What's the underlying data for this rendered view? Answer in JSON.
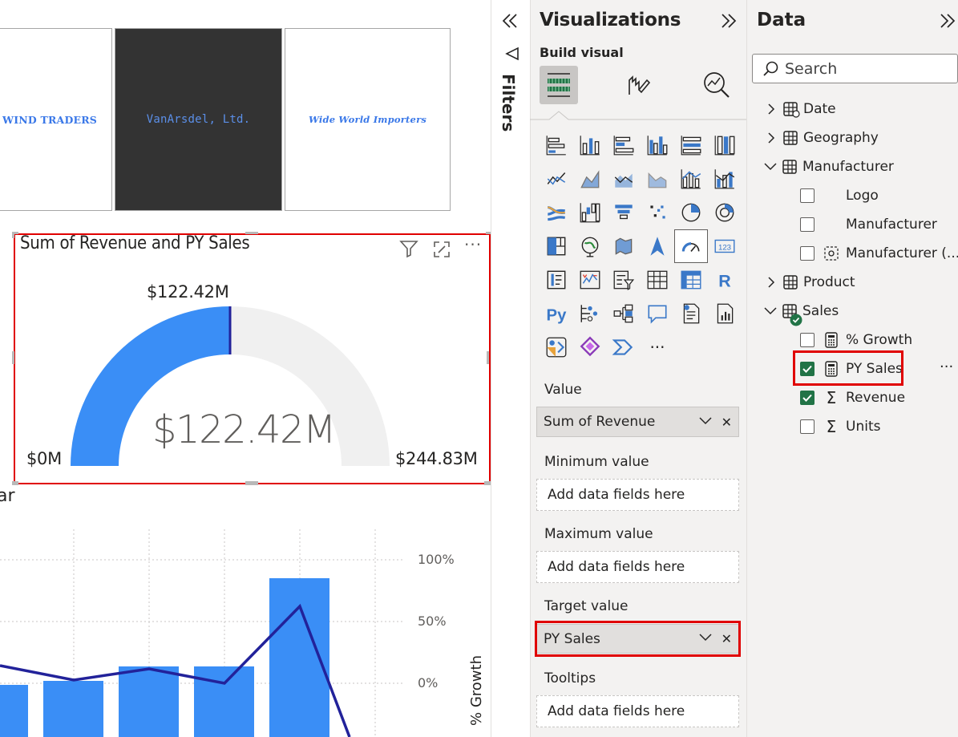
{
  "canvas": {
    "logos": [
      {
        "text": "WIND TRADERS",
        "color": "#3a78e8"
      },
      {
        "text": "VanArsdel, Ltd.",
        "color": "#5b8fe8"
      },
      {
        "text": "Wide World Importers",
        "color": "#3a78e8"
      }
    ],
    "gauge": {
      "title": "Sum of Revenue and PY Sales",
      "target_label": "$122.42M",
      "center_value": "$122.42M",
      "min_label": "$0M",
      "max_label": "$244.83M",
      "value_fraction": 0.5,
      "fill_color": "#3a8ef6",
      "track_color": "#f0f0f0",
      "target_color": "#22229a"
    },
    "combo_chart": {
      "title_fragment": "ar",
      "y2_axis_label": "% Growth",
      "y2_ticks": [
        "100%",
        "50%",
        "0%"
      ]
    }
  },
  "filters": {
    "label": "Filters"
  },
  "visualizations": {
    "title": "Visualizations",
    "build_visual_label": "Build visual",
    "wells": [
      {
        "label": "Value",
        "field": "Sum of Revenue",
        "placeholder": ""
      },
      {
        "label": "Minimum value",
        "field": "",
        "placeholder": "Add data fields here"
      },
      {
        "label": "Maximum value",
        "field": "",
        "placeholder": "Add data fields here"
      },
      {
        "label": "Target value",
        "field": "PY Sales",
        "placeholder": ""
      },
      {
        "label": "Tooltips",
        "field": "",
        "placeholder": "Add data fields here"
      }
    ],
    "more_label": "···"
  },
  "data": {
    "title": "Data",
    "search_placeholder": "Search",
    "tables": [
      {
        "name": "Date",
        "expanded": false
      },
      {
        "name": "Geography",
        "expanded": false
      },
      {
        "name": "Manufacturer",
        "expanded": true,
        "fields": [
          {
            "name": "Logo",
            "checked": false
          },
          {
            "name": "Manufacturer",
            "checked": false
          },
          {
            "name": "Manufacturer (...",
            "checked": false
          }
        ]
      },
      {
        "name": "Product",
        "expanded": false
      },
      {
        "name": "Sales",
        "expanded": true,
        "fields": [
          {
            "name": "% Growth",
            "checked": false
          },
          {
            "name": "PY Sales",
            "checked": true
          },
          {
            "name": "Revenue",
            "checked": true
          },
          {
            "name": "Units",
            "checked": false
          }
        ]
      }
    ],
    "row_more": "···"
  },
  "colors": {
    "accent_red": "#e00000",
    "check_green": "#217346",
    "bar_blue": "#3a8ef6",
    "line_navy": "#22229a"
  }
}
